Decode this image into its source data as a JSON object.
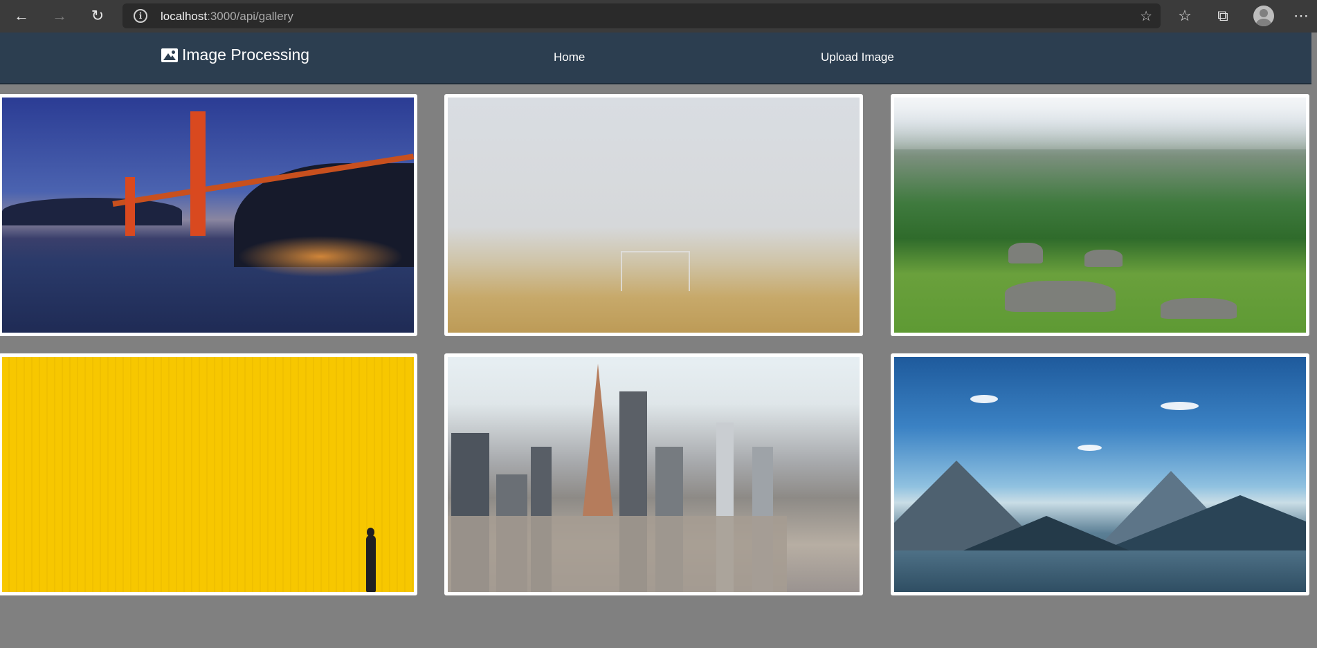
{
  "browser": {
    "url_host": "localhost",
    "url_rest": ":3000/api/gallery",
    "info_glyph": "i",
    "back_icon": "back-arrow-icon",
    "forward_icon": "forward-arrow-icon",
    "reload_icon": "reload-icon",
    "favorite_icon": "add-favorite-icon",
    "favorites_icon": "favorites-icon",
    "collections_icon": "collections-icon",
    "profile_icon": "profile-avatar-icon",
    "menu_icon": "more-menu-icon"
  },
  "app": {
    "brand_label": "Image Processing",
    "nav": [
      {
        "label": "Home"
      },
      {
        "label": "Upload Image"
      }
    ],
    "colors": {
      "navbar": "#2c3e50",
      "background": "#808080",
      "card": "#ffffff"
    }
  },
  "gallery": {
    "images": [
      {
        "subject": "golden-gate-bridge-dusk"
      },
      {
        "subject": "foggy-field-goal"
      },
      {
        "subject": "green-alpine-valley"
      },
      {
        "subject": "yellow-wall-person"
      },
      {
        "subject": "city-skyline"
      },
      {
        "subject": "blue-mountain-valley"
      }
    ]
  }
}
